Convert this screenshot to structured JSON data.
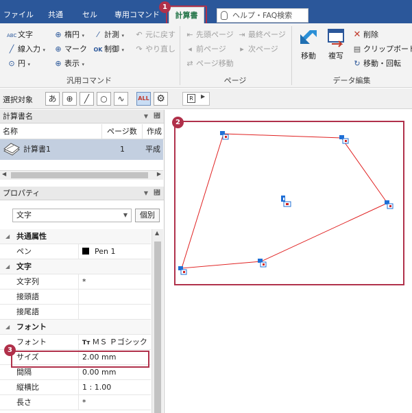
{
  "tabs": [
    {
      "label": "ファイル"
    },
    {
      "label": "共通"
    },
    {
      "label": "セル"
    },
    {
      "label": "専用コマンド"
    },
    {
      "label": "計算書"
    }
  ],
  "help": {
    "placeholder": "ヘルプ・FAQ検索"
  },
  "badges": [
    "1",
    "2",
    "3"
  ],
  "ribbon": {
    "general": {
      "label": "汎用コマンド",
      "text": "文字",
      "leader": "線入力",
      "circle": "円",
      "ellipse": "楕円",
      "mark": "マーク",
      "view": "表示",
      "measure": "計測",
      "control": "制御",
      "undo": "元に戻す",
      "redo": "やり直し"
    },
    "page": {
      "label": "ページ",
      "first": "先頭ページ",
      "last": "最終ページ",
      "prev": "前ページ",
      "next": "次ページ",
      "move": "ページ移動"
    },
    "data": {
      "label": "データ編集",
      "move": "移動",
      "copy": "複写",
      "delete": "削除",
      "clipboard": "クリップボード",
      "move_rotate": "移動・回転"
    }
  },
  "toolbar": {
    "select_label": "選択対象",
    "text_btn": "あ",
    "all_btn": "ALL",
    "r_btn": "R"
  },
  "calc_panel": {
    "title": "計算書名",
    "col_name": "名称",
    "col_pages": "ページ数",
    "col_created": "作成",
    "row": {
      "name": "計算書1",
      "pages": "1",
      "created": "平成"
    }
  },
  "prop_panel": {
    "title": "プロパティ",
    "type_value": "文字",
    "individual": "個別",
    "rows": [
      {
        "kind": "cat",
        "key": "共通属性"
      },
      {
        "kind": "row",
        "key": "ペン",
        "value": "Pen 1"
      },
      {
        "kind": "cat",
        "key": "文字"
      },
      {
        "kind": "row",
        "key": "文字列",
        "value": "*"
      },
      {
        "kind": "row",
        "key": "接頭語",
        "value": ""
      },
      {
        "kind": "row",
        "key": "接尾語",
        "value": ""
      },
      {
        "kind": "cat",
        "key": "フォント"
      },
      {
        "kind": "row",
        "key": "フォント",
        "value": "ＭＳ Ｐゴシック"
      },
      {
        "kind": "row",
        "key": "サイズ",
        "value": "2.00 mm"
      },
      {
        "kind": "row",
        "key": "間隔",
        "value": "0.00 mm"
      },
      {
        "kind": "row",
        "key": "縦横比",
        "value": "1 : 1.00"
      },
      {
        "kind": "row",
        "key": "長さ",
        "value": "*"
      }
    ]
  },
  "colors": {
    "accent": "#b0304a",
    "tabbar": "#2b579a",
    "polyline": "#e02020",
    "handle": "#1f6fd6",
    "selected_row": "#c3cfe0"
  }
}
